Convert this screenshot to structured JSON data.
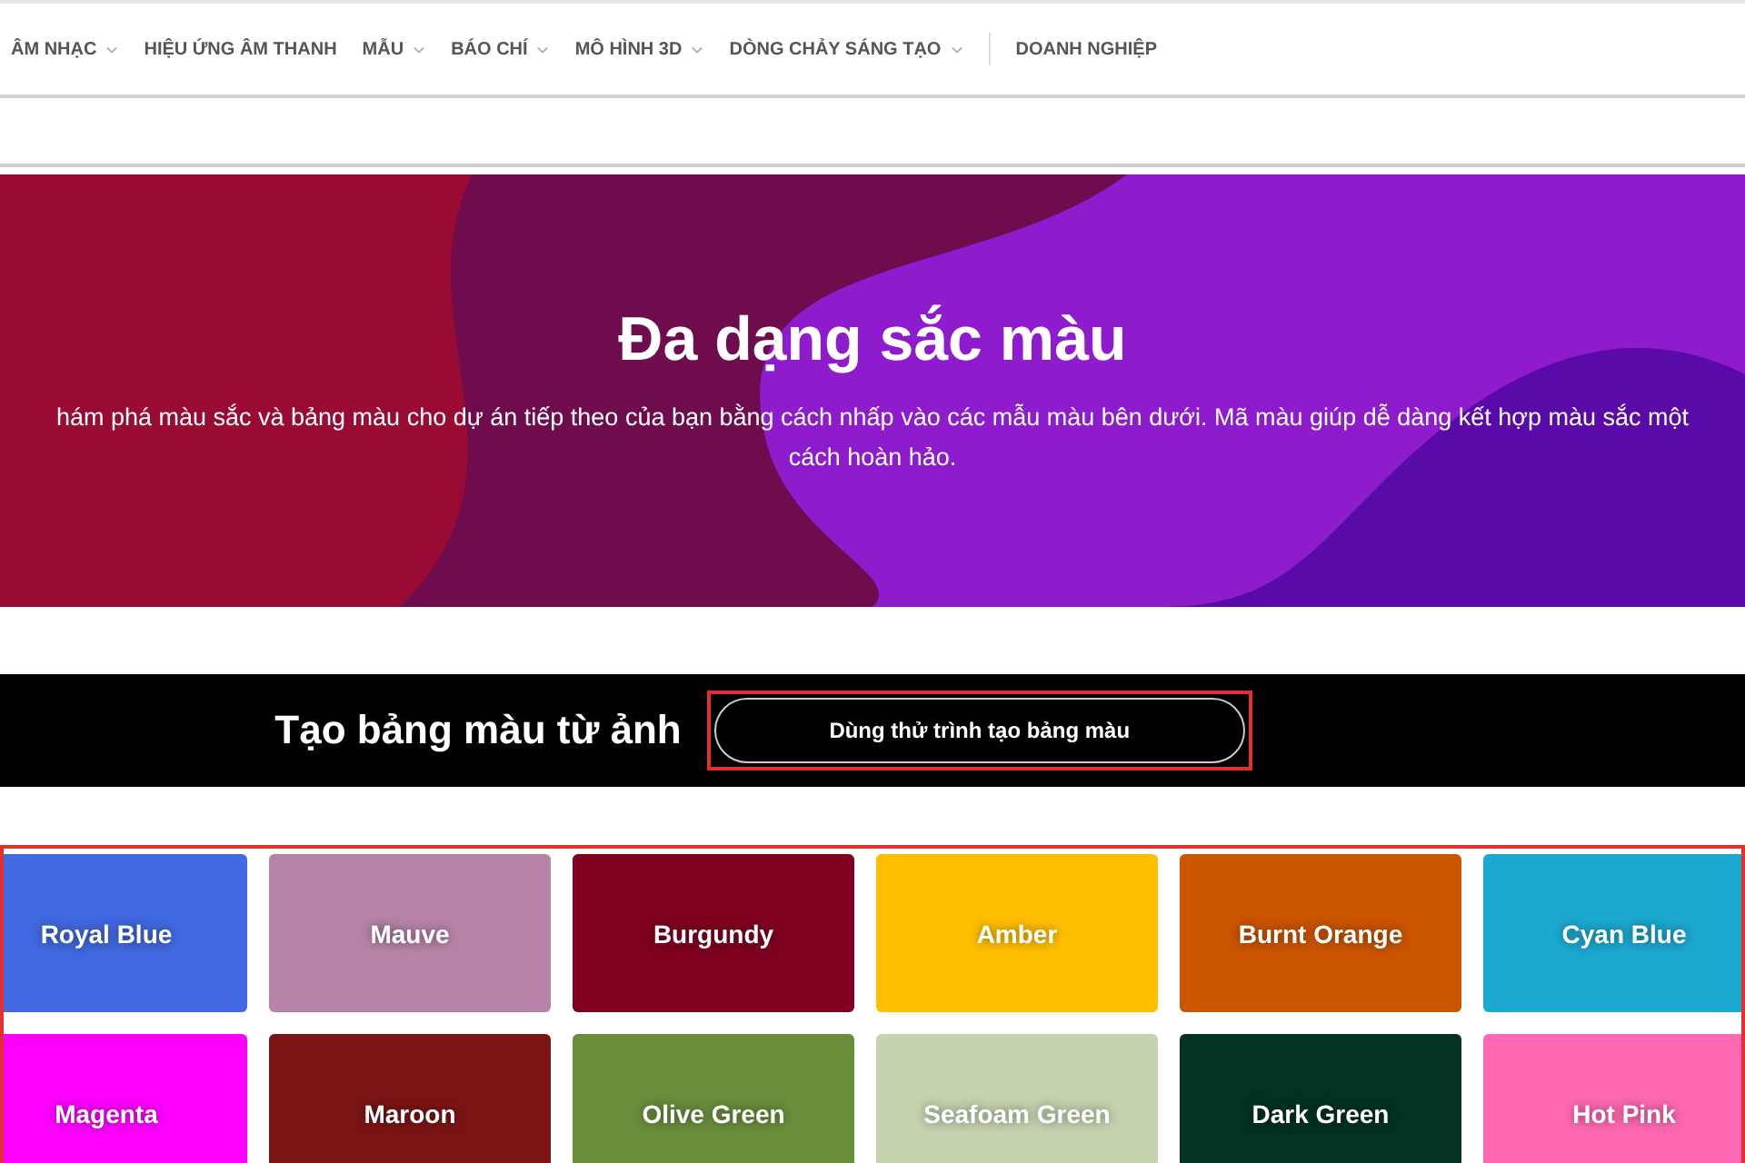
{
  "nav": {
    "items": [
      {
        "label": "ÂM NHẠC",
        "dropdown": true
      },
      {
        "label": "HIỆU ỨNG ÂM THANH",
        "dropdown": false
      },
      {
        "label": "MẪU",
        "dropdown": true
      },
      {
        "label": "BÁO CHÍ",
        "dropdown": true
      },
      {
        "label": "MÔ HÌNH 3D",
        "dropdown": true
      },
      {
        "label": "DÒNG CHẢY SÁNG TẠO",
        "dropdown": true
      }
    ],
    "extra": "DOANH NGHIỆP"
  },
  "hero": {
    "title": "Đa dạng sắc màu",
    "description": [
      "hám phá màu sắc và bảng màu cho dự án tiếp theo của bạn bằng cách nhấp vào các mẫu màu bên dưới. Mã màu giúp dễ dàng kết hợp màu sắc một",
      "cách hoàn hảo."
    ]
  },
  "banner": {
    "title": "Tạo bảng màu từ ảnh",
    "button": "Dùng thử trình tạo bảng màu"
  },
  "colors": [
    {
      "name": "Royal Blue",
      "color": "#4169e1"
    },
    {
      "name": "Mauve",
      "color": "#b784a7"
    },
    {
      "name": "Burgundy",
      "color": "#800020"
    },
    {
      "name": "Amber",
      "color": "#ffbf00"
    },
    {
      "name": "Burnt Orange",
      "color": "#cc5500"
    },
    {
      "name": "Cyan Blue",
      "color": "#1ca9d0"
    },
    {
      "name": "Magenta",
      "color": "#ff00ff"
    },
    {
      "name": "Maroon",
      "color": "#7b1515"
    },
    {
      "name": "Olive Green",
      "color": "#6b8e3d"
    },
    {
      "name": "Seafoam Green",
      "color": "#c6d3b0"
    },
    {
      "name": "Dark Green",
      "color": "#033222"
    },
    {
      "name": "Hot Pink",
      "color": "#ff69b4"
    }
  ]
}
